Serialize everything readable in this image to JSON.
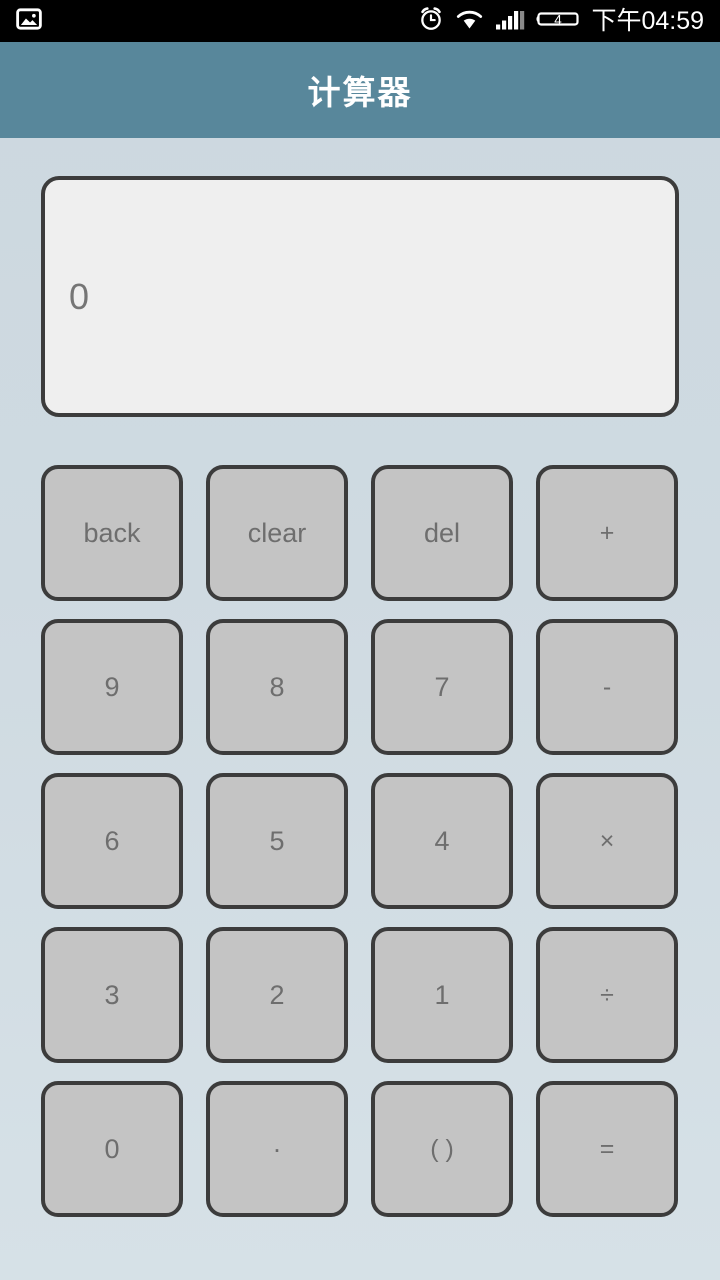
{
  "statusbar": {
    "left_icons": [
      {
        "name": "gallery-image-icon",
        "glyph": "image"
      }
    ],
    "right_icons": [
      {
        "name": "alarm-clock-icon",
        "glyph": "alarm"
      },
      {
        "name": "wifi-icon",
        "glyph": "wifi"
      },
      {
        "name": "cellular-signal-icon",
        "glyph": "signal"
      },
      {
        "name": "battery-icon",
        "glyph": "battery"
      }
    ],
    "battery_level_label": "4",
    "clock": "下午04:59"
  },
  "titlebar": {
    "title": "计算器",
    "background_color": "#58879b",
    "text_color": "#ffffff"
  },
  "display": {
    "value": "0",
    "background_color": "#efefef",
    "border_color": "#3c3c3c",
    "text_color": "#757575"
  },
  "keypad": {
    "button_fill_color": "#c4c4c4",
    "button_border_color": "#3c3c3c",
    "button_text_color": "#6e6e6e",
    "keys": [
      {
        "label": "back",
        "name": "key-back",
        "kind": "action"
      },
      {
        "label": "clear",
        "name": "key-clear",
        "kind": "action"
      },
      {
        "label": "del",
        "name": "key-del",
        "kind": "action"
      },
      {
        "label": "+",
        "name": "key-plus",
        "kind": "operator"
      },
      {
        "label": "9",
        "name": "key-9",
        "kind": "digit"
      },
      {
        "label": "8",
        "name": "key-8",
        "kind": "digit"
      },
      {
        "label": "7",
        "name": "key-7",
        "kind": "digit"
      },
      {
        "label": "-",
        "name": "key-minus",
        "kind": "operator"
      },
      {
        "label": "6",
        "name": "key-6",
        "kind": "digit"
      },
      {
        "label": "5",
        "name": "key-5",
        "kind": "digit"
      },
      {
        "label": "4",
        "name": "key-4",
        "kind": "digit"
      },
      {
        "label": "×",
        "name": "key-multiply",
        "kind": "operator"
      },
      {
        "label": "3",
        "name": "key-3",
        "kind": "digit"
      },
      {
        "label": "2",
        "name": "key-2",
        "kind": "digit"
      },
      {
        "label": "1",
        "name": "key-1",
        "kind": "digit"
      },
      {
        "label": "÷",
        "name": "key-divide",
        "kind": "operator"
      },
      {
        "label": "0",
        "name": "key-0",
        "kind": "digit"
      },
      {
        "label": "·",
        "name": "key-decimal",
        "kind": "decimal"
      },
      {
        "label": "( )",
        "name": "key-parens",
        "kind": "operator"
      },
      {
        "label": "=",
        "name": "key-equals",
        "kind": "operator"
      }
    ]
  },
  "page": {
    "background_top_color": "#ccd8e0",
    "background_bottom_color": "#d6e1e7"
  }
}
